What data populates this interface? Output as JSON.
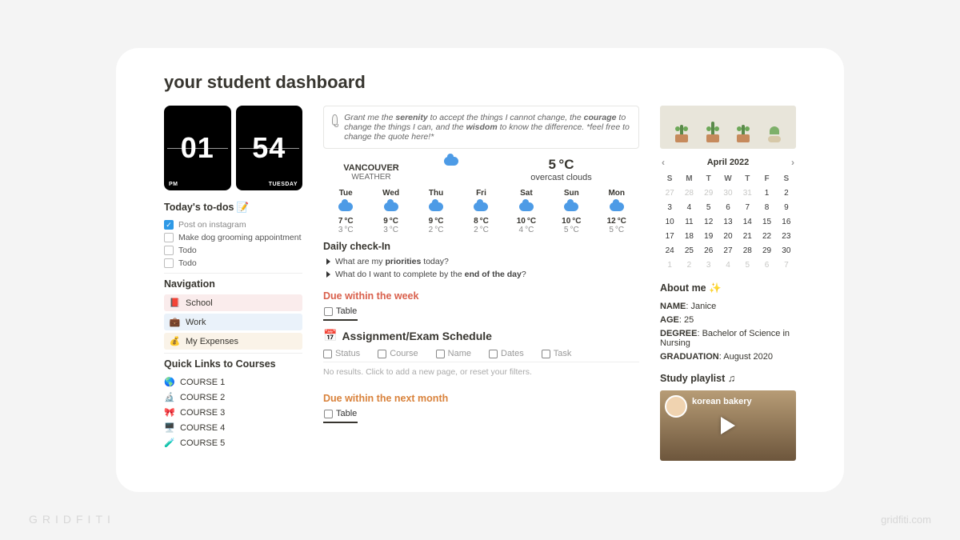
{
  "page_title": "your student dashboard",
  "clock": {
    "hour": "01",
    "minute": "54",
    "ampm": "PM",
    "day": "TUESDAY"
  },
  "todos": {
    "heading": "Today's to-dos 📝",
    "items": [
      {
        "label": "Post on instagram",
        "done": true
      },
      {
        "label": "Make dog grooming appointment",
        "done": false
      },
      {
        "label": "Todo",
        "done": false
      },
      {
        "label": "Todo",
        "done": false
      }
    ]
  },
  "navigation": {
    "heading": "Navigation",
    "items": [
      {
        "emoji": "📕",
        "label": "School",
        "cls": "nav-school"
      },
      {
        "emoji": "💼",
        "label": "Work",
        "cls": "nav-work"
      },
      {
        "emoji": "💰",
        "label": "My Expenses",
        "cls": "nav-expense"
      }
    ]
  },
  "quick_links": {
    "heading": "Quick Links to Courses",
    "items": [
      {
        "emoji": "🌎",
        "label": "COURSE 1"
      },
      {
        "emoji": "🔬",
        "label": "COURSE 2"
      },
      {
        "emoji": "🎀",
        "label": "COURSE 3"
      },
      {
        "emoji": "🖥️",
        "label": "COURSE 4"
      },
      {
        "emoji": "🧪",
        "label": "COURSE 5"
      }
    ]
  },
  "quote": {
    "text_parts": [
      "Grant me the ",
      "serenity",
      " to accept the things I cannot change, the ",
      "courage",
      " to change the things I can, and the ",
      "wisdom",
      " to know the difference. *feel free to change the quote here!*"
    ]
  },
  "weather": {
    "city": "VANCOUVER",
    "city_sub": "WEATHER",
    "current_temp": "5 °C",
    "current_desc": "overcast clouds",
    "days": [
      {
        "name": "Tue",
        "hi": "7 °C",
        "lo": "3 °C"
      },
      {
        "name": "Wed",
        "hi": "9 °C",
        "lo": "3 °C"
      },
      {
        "name": "Thu",
        "hi": "9 °C",
        "lo": "2 °C"
      },
      {
        "name": "Fri",
        "hi": "8 °C",
        "lo": "2 °C"
      },
      {
        "name": "Sat",
        "hi": "10 °C",
        "lo": "4 °C"
      },
      {
        "name": "Sun",
        "hi": "10 °C",
        "lo": "5 °C"
      },
      {
        "name": "Mon",
        "hi": "12 °C",
        "lo": "5 °C"
      }
    ]
  },
  "daily_checkin": {
    "heading": "Daily check-In",
    "toggles": [
      {
        "pre": "What are my ",
        "bold": "priorities",
        "post": " today?"
      },
      {
        "pre": "What do I want to complete by the ",
        "bold": "end of the day",
        "post": "?"
      }
    ]
  },
  "due_week": {
    "heading": "Due within the week",
    "view_label": "Table",
    "table_title": "Assignment/Exam Schedule",
    "table_emoji": "📅",
    "columns": [
      "Status",
      "Course",
      "Name",
      "Dates",
      "Task"
    ],
    "empty_text": "No results. Click to add a new page, or reset your filters."
  },
  "due_month": {
    "heading": "Due within the next month",
    "view_label": "Table"
  },
  "calendar": {
    "month_label": "April 2022",
    "weekday_heads": [
      "S",
      "M",
      "T",
      "W",
      "T",
      "F",
      "S"
    ],
    "cells": [
      {
        "n": "27",
        "mute": true
      },
      {
        "n": "28",
        "mute": true
      },
      {
        "n": "29",
        "mute": true
      },
      {
        "n": "30",
        "mute": true
      },
      {
        "n": "31",
        "mute": true
      },
      {
        "n": "1"
      },
      {
        "n": "2"
      },
      {
        "n": "3"
      },
      {
        "n": "4"
      },
      {
        "n": "5"
      },
      {
        "n": "6"
      },
      {
        "n": "7"
      },
      {
        "n": "8"
      },
      {
        "n": "9"
      },
      {
        "n": "10"
      },
      {
        "n": "11"
      },
      {
        "n": "12"
      },
      {
        "n": "13"
      },
      {
        "n": "14"
      },
      {
        "n": "15"
      },
      {
        "n": "16"
      },
      {
        "n": "17"
      },
      {
        "n": "18"
      },
      {
        "n": "19"
      },
      {
        "n": "20"
      },
      {
        "n": "21"
      },
      {
        "n": "22"
      },
      {
        "n": "23"
      },
      {
        "n": "24"
      },
      {
        "n": "25"
      },
      {
        "n": "26"
      },
      {
        "n": "27"
      },
      {
        "n": "28"
      },
      {
        "n": "29"
      },
      {
        "n": "30"
      },
      {
        "n": "1",
        "mute": true
      },
      {
        "n": "2",
        "mute": true
      },
      {
        "n": "3",
        "mute": true
      },
      {
        "n": "4",
        "mute": true
      },
      {
        "n": "5",
        "mute": true
      },
      {
        "n": "6",
        "mute": true
      },
      {
        "n": "7",
        "mute": true
      }
    ]
  },
  "about": {
    "heading": "About me ✨",
    "lines": [
      {
        "k": "NAME",
        "v": "Janice"
      },
      {
        "k": "AGE",
        "v": "25"
      },
      {
        "k": "DEGREE",
        "v": "Bachelor of Science in Nursing"
      },
      {
        "k": "GRADUATION",
        "v": "August 2020"
      }
    ]
  },
  "playlist": {
    "heading": "Study playlist ♫",
    "video_title": "korean bakery"
  },
  "watermark": {
    "left": "GRIDFITI",
    "right": "gridfiti.com"
  }
}
